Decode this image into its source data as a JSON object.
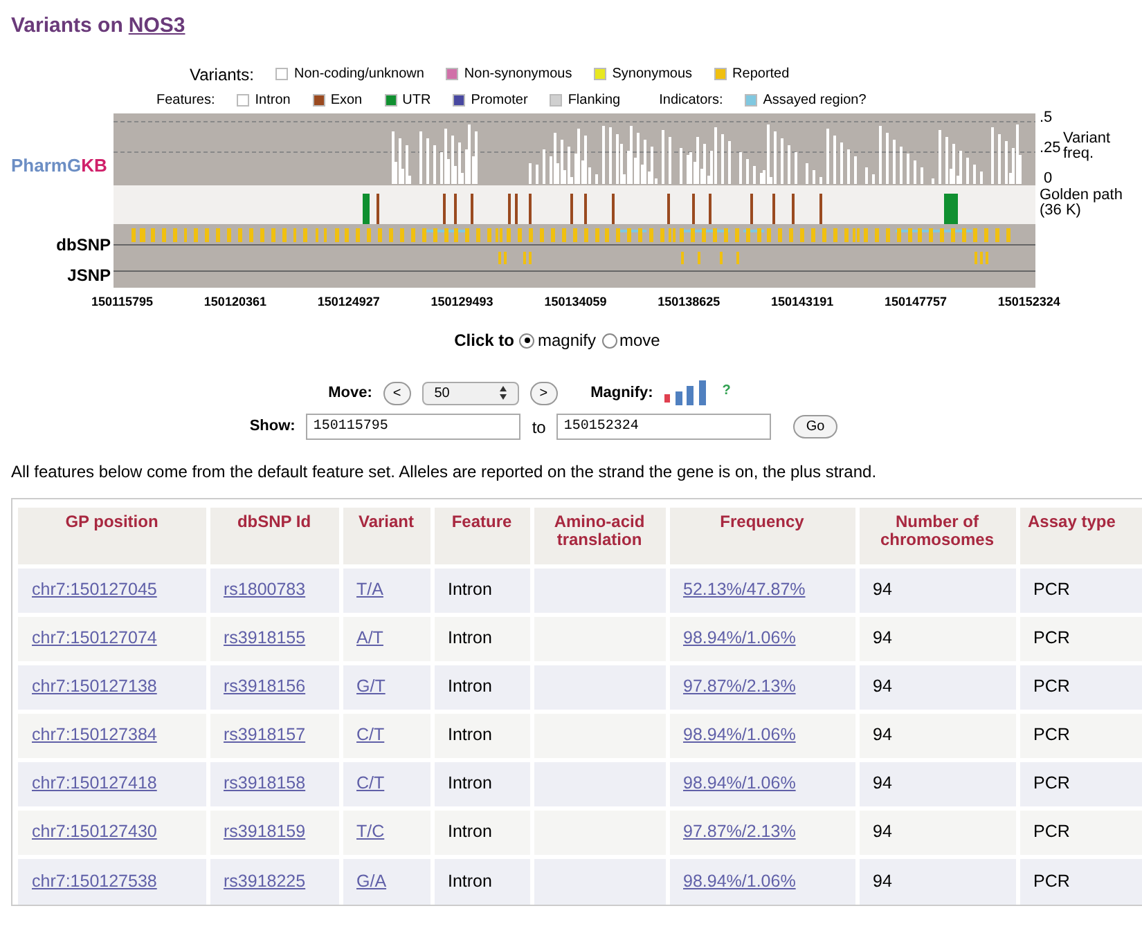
{
  "title": {
    "text": "Variants on",
    "gene": "NOS3"
  },
  "legend": {
    "variants_label": "Variants:",
    "variants": [
      {
        "label": "Non-coding/unknown",
        "color": "#ffffff"
      },
      {
        "label": "Non-synonymous",
        "color": "#d070a8"
      },
      {
        "label": "Synonymous",
        "color": "#e8e820"
      },
      {
        "label": "Reported",
        "color": "#f0c010"
      }
    ],
    "features_label": "Features:",
    "features": [
      {
        "label": "Intron",
        "color": "#ffffff"
      },
      {
        "label": "Exon",
        "color": "#9a4a20"
      },
      {
        "label": "UTR",
        "color": "#109030"
      },
      {
        "label": "Promoter",
        "color": "#4848a0"
      },
      {
        "label": "Flanking",
        "color": "#d0d0d0"
      }
    ],
    "indicators_label": "Indicators:",
    "indicators": [
      {
        "label": "Assayed region?",
        "color": "#80c8e0"
      }
    ]
  },
  "tracks": {
    "pharmgkb": {
      "part_1": "PharmG",
      "part_2": "KB"
    },
    "dbsnp": "dbSNP",
    "jsnp": "JSNP",
    "freq_ticks": [
      ".5",
      ".25",
      "0"
    ],
    "freq_label": "Variant freq.",
    "golden_path": "Golden path (36 K)",
    "positions": [
      "150115795",
      "150120361",
      "150124927",
      "150129493",
      "150134059",
      "150138625",
      "150143191",
      "150147757",
      "150152324"
    ]
  },
  "click_to": {
    "label": "Click to",
    "options": [
      {
        "label": "magnify",
        "selected": true
      },
      {
        "label": "move",
        "selected": false
      }
    ]
  },
  "move": {
    "label": "Move:",
    "prev": "<",
    "value": "50",
    "next": ">"
  },
  "magnify": {
    "label": "Magnify:",
    "help": "?"
  },
  "show": {
    "label": "Show:",
    "from": "150115795",
    "to_label": "to",
    "to": "150152324",
    "button": "Go"
  },
  "note": "All features below come from the default feature set. Alleles are reported on the strand the gene is on, the plus strand.",
  "table": {
    "columns": [
      "GP position",
      "dbSNP Id",
      "Variant",
      "Feature",
      "Amino-acid translation",
      "Frequency",
      "Number of chromosomes",
      "Assay type"
    ],
    "rows": [
      [
        "chr7:150127045",
        "rs1800783",
        "T/A",
        "Intron",
        "",
        "52.13%/47.87%",
        "94",
        "PCR"
      ],
      [
        "chr7:150127074",
        "rs3918155",
        "A/T",
        "Intron",
        "",
        "98.94%/1.06%",
        "94",
        "PCR"
      ],
      [
        "chr7:150127138",
        "rs3918156",
        "G/T",
        "Intron",
        "",
        "97.87%/2.13%",
        "94",
        "PCR"
      ],
      [
        "chr7:150127384",
        "rs3918157",
        "C/T",
        "Intron",
        "",
        "98.94%/1.06%",
        "94",
        "PCR"
      ],
      [
        "chr7:150127418",
        "rs3918158",
        "C/T",
        "Intron",
        "",
        "98.94%/1.06%",
        "94",
        "PCR"
      ],
      [
        "chr7:150127430",
        "rs3918159",
        "T/C",
        "Intron",
        "",
        "97.87%/2.13%",
        "94",
        "PCR"
      ],
      [
        "chr7:150127538",
        "rs3918225",
        "G/A",
        "Intron",
        "",
        "98.94%/1.06%",
        "94",
        "PCR"
      ]
    ]
  }
}
